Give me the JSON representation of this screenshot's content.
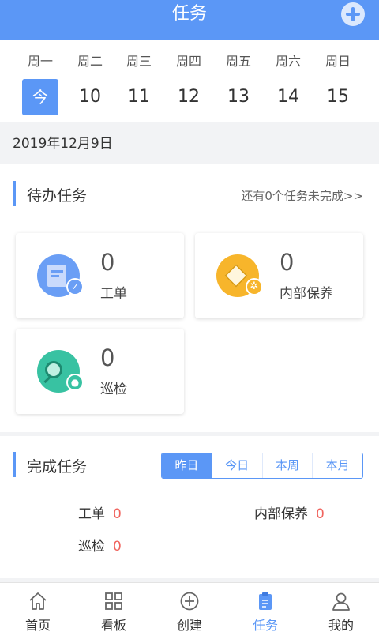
{
  "header": {
    "title": "任务",
    "add_icon": "plus-circle-icon"
  },
  "week": {
    "days": [
      "周一",
      "周二",
      "周三",
      "周四",
      "周五",
      "周六",
      "周日"
    ],
    "dates": [
      "今",
      "10",
      "11",
      "12",
      "13",
      "14",
      "15"
    ]
  },
  "current_date": "2019年12月9日",
  "pending": {
    "title": "待办任务",
    "more_link": "还有0个任务未完成>>",
    "cards": [
      {
        "count": "0",
        "label": "工单",
        "icon": "work-order-icon",
        "color": "#6a9ef5"
      },
      {
        "count": "0",
        "label": "内部保养",
        "icon": "maintenance-box-icon",
        "color": "#f7b52b"
      },
      {
        "count": "0",
        "label": "巡检",
        "icon": "inspection-icon",
        "color": "#38c2a2"
      }
    ]
  },
  "completed": {
    "title": "完成任务",
    "periods": [
      "昨日",
      "今日",
      "本周",
      "本月"
    ],
    "active_period": "昨日",
    "stats": [
      {
        "label": "工单",
        "value": "0"
      },
      {
        "label": "内部保养",
        "value": "0"
      },
      {
        "label": "巡检",
        "value": "0"
      }
    ]
  },
  "tabbar": {
    "items": [
      {
        "label": "首页",
        "icon": "home-icon"
      },
      {
        "label": "看板",
        "icon": "dashboard-grid-icon"
      },
      {
        "label": "创建",
        "icon": "create-plus-icon"
      },
      {
        "label": "任务",
        "icon": "task-clipboard-icon"
      },
      {
        "label": "我的",
        "icon": "user-icon"
      }
    ],
    "active": "任务"
  },
  "colors": {
    "accent": "#5b97f6",
    "value_red": "#f0645e"
  }
}
